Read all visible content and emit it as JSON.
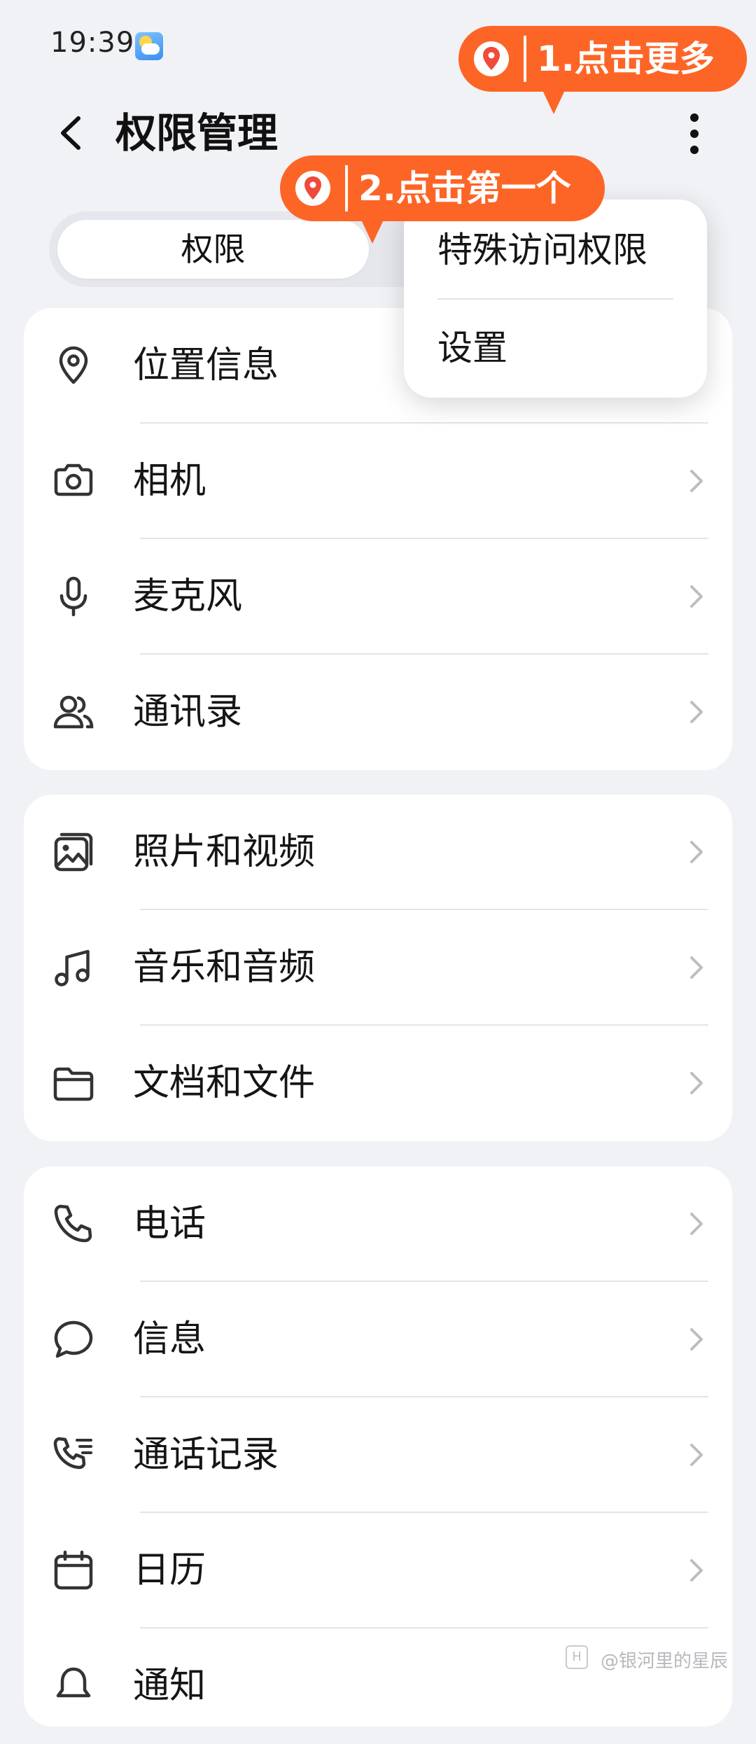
{
  "status_bar": {
    "time": "19:39"
  },
  "header": {
    "title": "权限管理"
  },
  "tabs": {
    "permissions_label": "权限"
  },
  "popup_menu": {
    "items": [
      "特殊访问权限",
      "设置"
    ]
  },
  "groups": [
    {
      "items": [
        {
          "label": "位置信息",
          "icon": "location-pin-icon"
        },
        {
          "label": "相机",
          "icon": "camera-icon"
        },
        {
          "label": "麦克风",
          "icon": "microphone-icon"
        },
        {
          "label": "通讯录",
          "icon": "contacts-icon"
        }
      ]
    },
    {
      "items": [
        {
          "label": "照片和视频",
          "icon": "photo-icon"
        },
        {
          "label": "音乐和音频",
          "icon": "music-note-icon"
        },
        {
          "label": "文档和文件",
          "icon": "folder-icon"
        }
      ]
    },
    {
      "items": [
        {
          "label": "电话",
          "icon": "phone-icon"
        },
        {
          "label": "信息",
          "icon": "message-bubble-icon"
        },
        {
          "label": "通话记录",
          "icon": "call-log-icon"
        },
        {
          "label": "日历",
          "icon": "calendar-icon"
        },
        {
          "label": "通知",
          "icon": "bell-icon"
        }
      ]
    }
  ],
  "annotations": {
    "step1": "1.点击更多",
    "step2": "2.点击第一个"
  },
  "watermark": "@银河里的星辰",
  "colors": {
    "annotation": "#fd6526",
    "background": "#f1f2f6",
    "card": "#ffffff"
  }
}
